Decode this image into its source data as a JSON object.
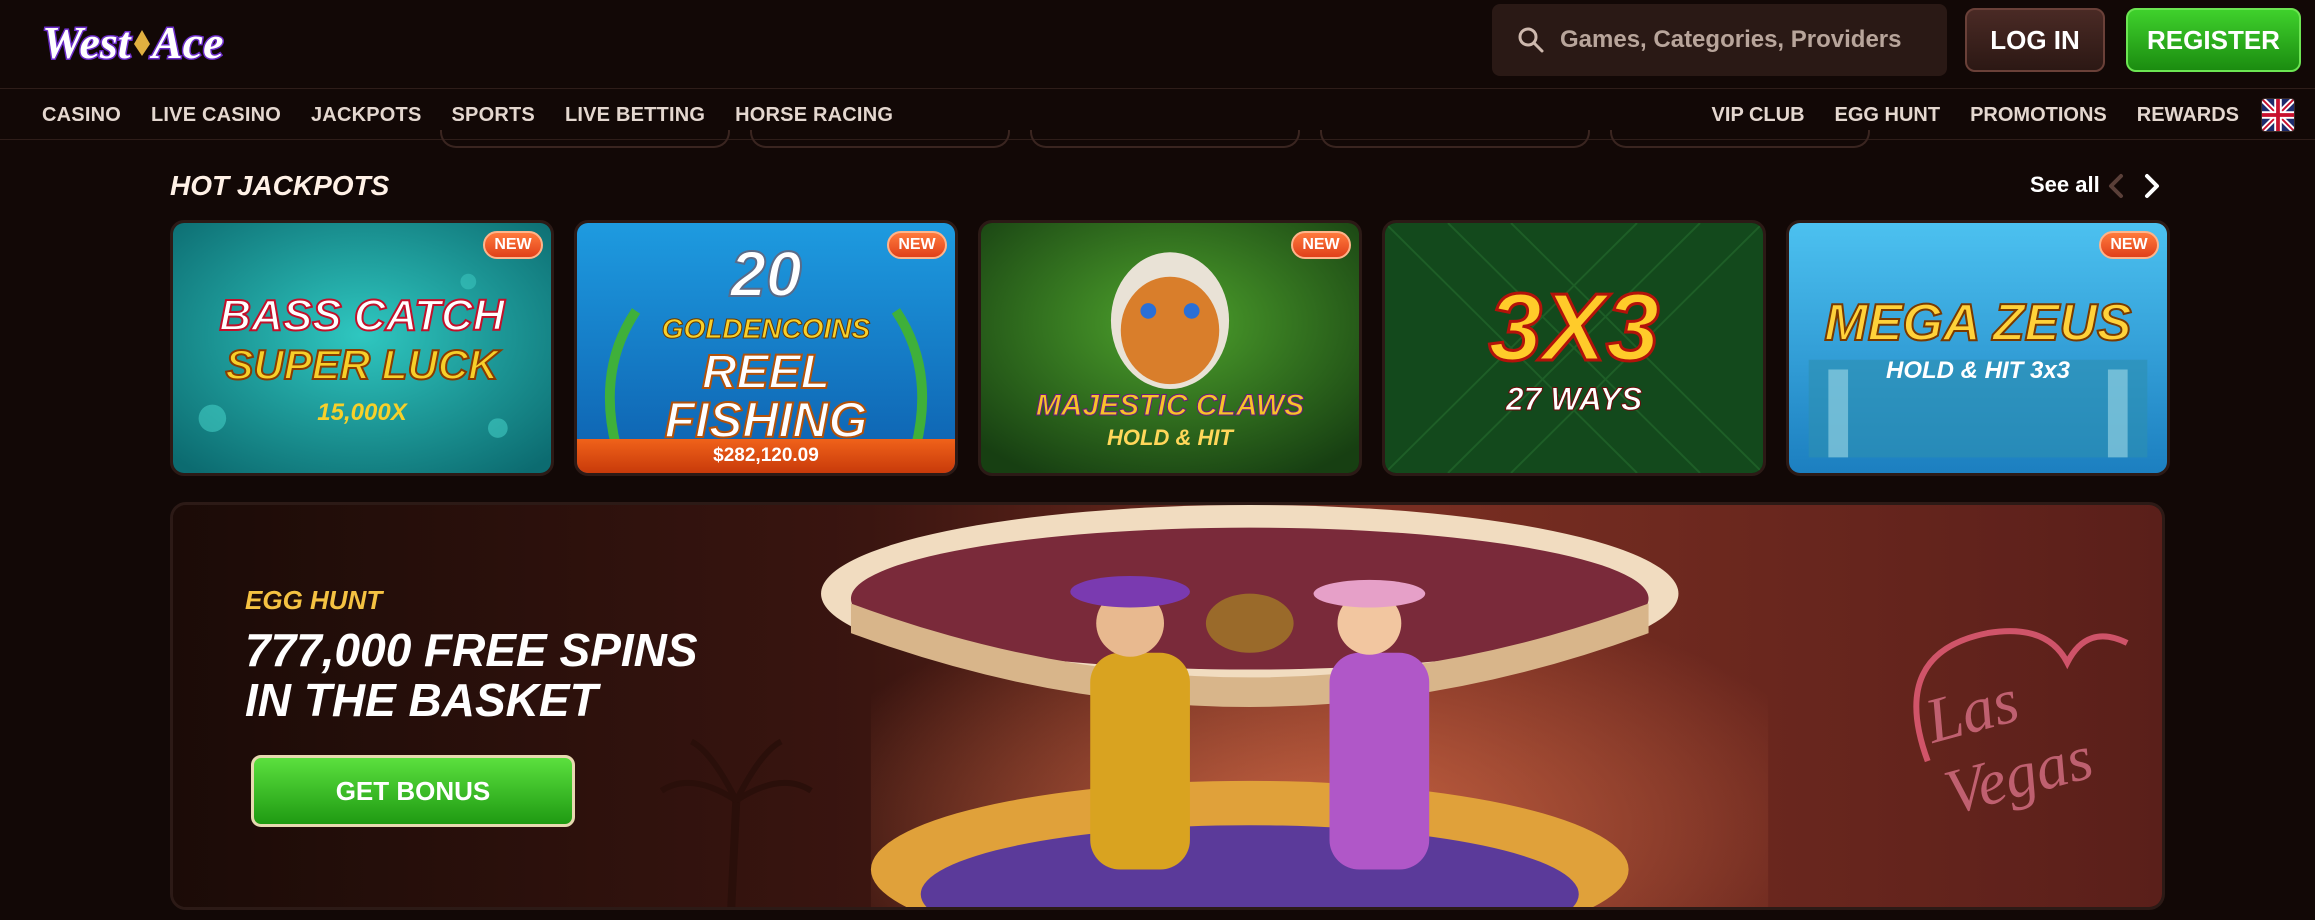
{
  "header": {
    "logo_text": "WestAce",
    "search_placeholder": "Games, Categories, Providers",
    "login_label": "LOG IN",
    "register_label": "REGISTER"
  },
  "nav": {
    "left": [
      "CASINO",
      "LIVE CASINO",
      "JACKPOTS",
      "SPORTS",
      "LIVE BETTING",
      "HORSE RACING"
    ],
    "right": [
      "VIP CLUB",
      "EGG HUNT",
      "PROMOTIONS",
      "REWARDS"
    ],
    "language_icon": "uk-flag-icon"
  },
  "jackpots": {
    "title": "HOT JACKPOTS",
    "see_all": "See all",
    "games": [
      {
        "name": "BASS CATCH SUPER LUCK",
        "line1": "BASS CATCH",
        "line2": "SUPER LUCK",
        "line3": "15,000X",
        "badge": "NEW"
      },
      {
        "name": "20 GOLDEN COINS REEL FISHING",
        "line1": "20",
        "line2": "GOLDENCOINS",
        "line3": "REEL",
        "line4": "FISHING",
        "amount": "$282,120.09",
        "badge": "NEW"
      },
      {
        "name": "MAJESTIC CLAWS HOLD & HIT",
        "line1": "MAJESTIC CLAWS",
        "line2": "HOLD & HIT",
        "badge": "NEW"
      },
      {
        "name": "3X3 27 WAYS",
        "line1": "3X3",
        "line2": "27 WAYS"
      },
      {
        "name": "MEGA ZEUS HOLD & HIT 3x3",
        "line1": "MEGA ZEUS",
        "line2": "HOLD & HIT 3x3",
        "badge": "NEW"
      }
    ]
  },
  "promo": {
    "eyebrow": "EGG HUNT",
    "headline_line1": "777,000 FREE SPINS",
    "headline_line2": "IN THE BASKET",
    "cta_label": "GET BONUS",
    "neon_sign": "Las Vegas"
  },
  "colors": {
    "background": "#120806",
    "accent_green": "#2fbf1f",
    "accent_orange": "#e8501c",
    "gold": "#f5c242"
  }
}
